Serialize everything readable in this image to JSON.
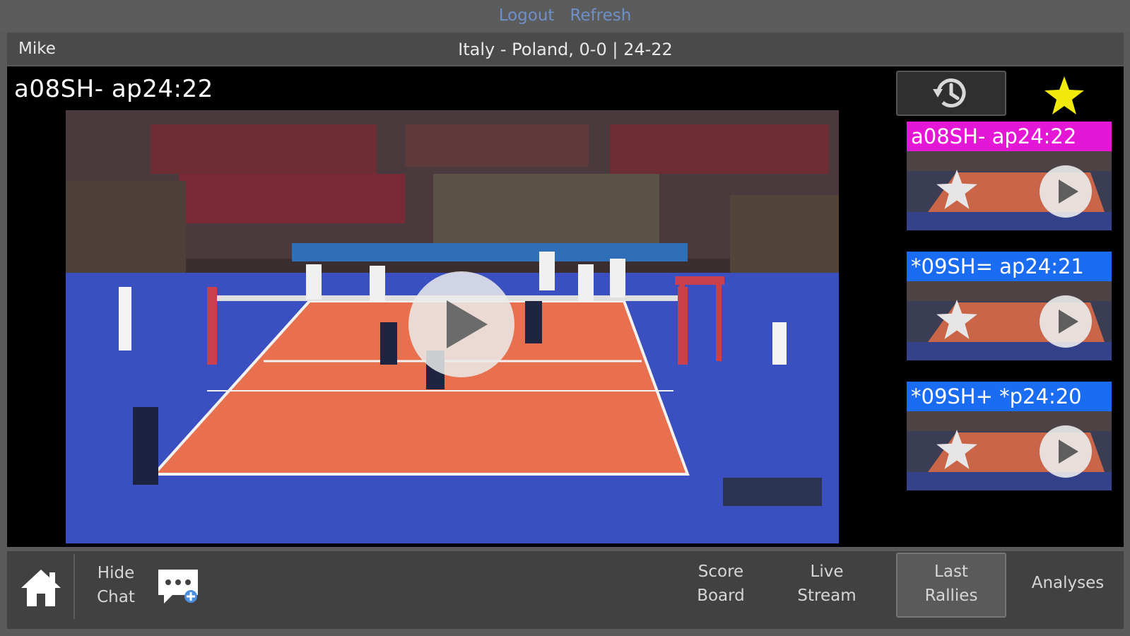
{
  "top_links": {
    "logout": "Logout",
    "refresh": "Refresh"
  },
  "info_bar": {
    "username": "Mike",
    "match": "Italy - Poland, 0-0 | 24-22"
  },
  "player": {
    "title": "a08SH- ap24:22"
  },
  "clips": [
    {
      "label": "a08SH-  ap24:22",
      "color": "#e417d6"
    },
    {
      "label": "*09SH=  ap24:21",
      "color": "#1a6cf2"
    },
    {
      "label": "*09SH+  *p24:20",
      "color": "#1a6cf2"
    }
  ],
  "bottom_nav": {
    "hide_chat": "Hide\nChat",
    "score_board": "Score\nBoard",
    "live_stream": "Live\nStream",
    "last_rallies": "Last\nRallies",
    "analyses": "Analyses"
  },
  "colors": {
    "favorite_star": "#f2ea0c",
    "court_inner": "#e8704e",
    "court_outer": "#3a4fc0"
  }
}
